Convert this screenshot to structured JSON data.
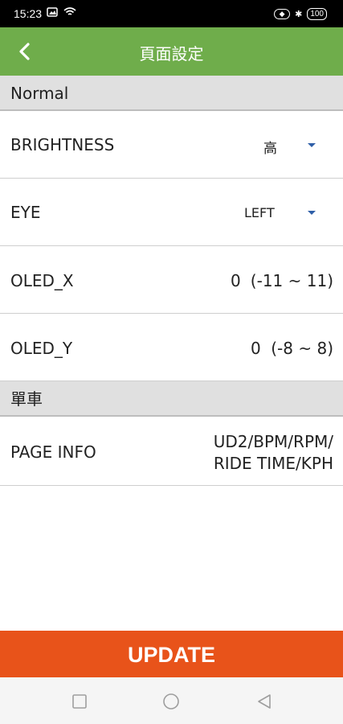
{
  "status_bar": {
    "time": "15:23",
    "battery": "100"
  },
  "app_bar": {
    "title": "頁面設定"
  },
  "sections": {
    "normal": {
      "title": "Normal",
      "brightness": {
        "label": "BRIGHTNESS",
        "value": "高"
      },
      "eye": {
        "label": "EYE",
        "value": "LEFT"
      },
      "oled_x": {
        "label": "OLED_X",
        "value": "0",
        "range": "(-11 ~ 11)"
      },
      "oled_y": {
        "label": "OLED_Y",
        "value": "0",
        "range": "(-8 ~ 8)"
      }
    },
    "bike": {
      "title": "單車",
      "page_info": {
        "label": "PAGE INFO",
        "value_line1": "UD2/BPM/RPM/",
        "value_line2": "RIDE TIME/KPH"
      }
    }
  },
  "update_button": {
    "label": "UPDATE"
  },
  "colors": {
    "app_bar": "#6fad4b",
    "update_button": "#e8531a",
    "section_header": "#e0e0e0",
    "caret": "#2f5fa8"
  },
  "icons": [
    "back-arrow-icon",
    "dropdown-caret-icon",
    "nav-square-icon",
    "nav-circle-icon",
    "nav-triangle-icon"
  ]
}
